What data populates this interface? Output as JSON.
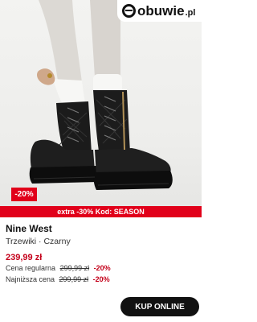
{
  "logo": {
    "text": "obuwie",
    "suffix": ".pl"
  },
  "product": {
    "image_alt": "Black quilted lace-up platform boots",
    "discount_badge": "-20%",
    "promo": "extra -30% Kod: SEASON",
    "brand": "Nine West",
    "subtitle": "Trzewiki · Czarny",
    "price": "239,99 zł",
    "regular_label": "Cena regularna",
    "regular_old": "299,99 zł",
    "regular_pct": "-20%",
    "lowest_label": "Najniższa cena",
    "lowest_old": "299,99 zł",
    "lowest_pct": "-20%"
  },
  "cta": {
    "label": "KUP ONLINE"
  },
  "colors": {
    "accent_red": "#e1001a",
    "price_red": "#c4001a",
    "button_bg": "#111111"
  }
}
